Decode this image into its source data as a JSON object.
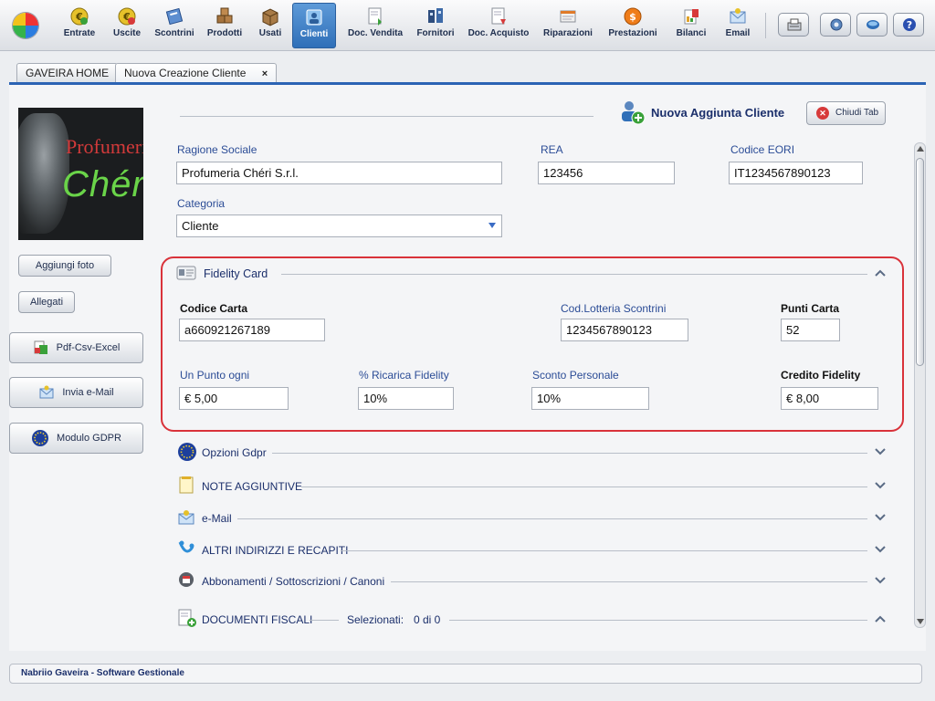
{
  "toolbar": {
    "items": [
      {
        "label": "Entrate",
        "icon": "coin-icon"
      },
      {
        "label": "Uscite",
        "icon": "coin-out-icon"
      },
      {
        "label": "Scontrini",
        "icon": "receipt-icon"
      },
      {
        "label": "Prodotti",
        "icon": "boxes-icon"
      },
      {
        "label": "Usati",
        "icon": "box-icon"
      },
      {
        "label": "Clienti",
        "icon": "customer-icon"
      },
      {
        "label": "Doc. Vendita",
        "icon": "sales-doc-icon"
      },
      {
        "label": "Fornitori",
        "icon": "suppliers-icon"
      },
      {
        "label": "Doc. Acquisto",
        "icon": "purchase-doc-icon"
      },
      {
        "label": "Riparazioni",
        "icon": "repair-icon"
      },
      {
        "label": "Prestazioni",
        "icon": "services-icon"
      },
      {
        "label": "Bilanci",
        "icon": "balance-icon"
      },
      {
        "label": "Email",
        "icon": "email-icon"
      }
    ],
    "active": "Clienti"
  },
  "tabs": [
    {
      "label": "GAVEIRA HOME"
    },
    {
      "label": "Nuova Creazione Cliente",
      "close": "×"
    }
  ],
  "photo": {
    "line1": "Profumeria",
    "line2": "Chéri"
  },
  "sidebar": {
    "add_photo": "Aggiungi foto",
    "attachments": "Allegati",
    "export": "Pdf-Csv-Excel",
    "send_email": "Invia e-Mail",
    "gdpr": "Modulo GDPR"
  },
  "header": {
    "title": "Nuova Aggiunta Cliente",
    "close_tab": "Chiudi Tab"
  },
  "form": {
    "ragione_sociale": {
      "label": "Ragione Sociale",
      "value": "Profumeria Chéri S.r.l."
    },
    "rea": {
      "label": "REA",
      "value": "123456"
    },
    "eori": {
      "label": "Codice EORI",
      "value": "IT1234567890123"
    },
    "categoria": {
      "label": "Categoria",
      "value": "Cliente"
    }
  },
  "fidelity": {
    "title": "Fidelity Card",
    "codice_carta": {
      "label": "Codice Carta",
      "value": "a660921267189"
    },
    "lotteria": {
      "label": "Cod.Lotteria Scontrini",
      "value": "1234567890123"
    },
    "punti": {
      "label": "Punti Carta",
      "value": "52"
    },
    "punto_ogni": {
      "label": "Un Punto ogni",
      "value": "€ 5,00"
    },
    "ricarica": {
      "label": "% Ricarica Fidelity",
      "value": "10%"
    },
    "sconto": {
      "label": "Sconto Personale",
      "value": "10%"
    },
    "credito": {
      "label": "Credito Fidelity",
      "value": "€ 8,00"
    }
  },
  "sections": {
    "gdpr": "Opzioni Gdpr",
    "note": "NOTE AGGIUNTIVE",
    "email": "e-Mail",
    "addresses": "ALTRI INDIRIZZI E RECAPITI",
    "subscriptions": "Abbonamenti / Sottoscrizioni / Canoni",
    "fiscal": "DOCUMENTI FISCALI",
    "selected_label": "Selezionati:",
    "selected_value": "0 di 0"
  },
  "status": "Nabriio Gaveira - Software Gestionale",
  "colors": {
    "accent": "#2b63b4",
    "highlight_border": "#d9323a",
    "label": "#2b4c96"
  }
}
